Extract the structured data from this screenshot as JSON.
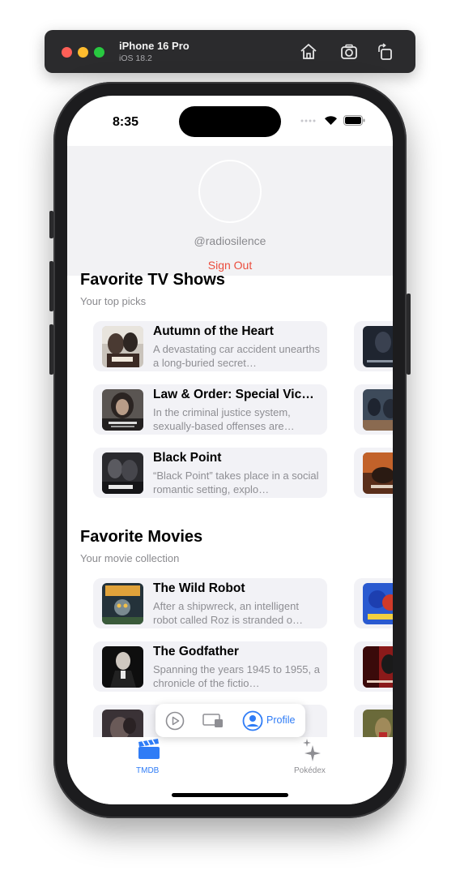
{
  "simulator": {
    "device": "iPhone 16 Pro",
    "os": "iOS 18.2"
  },
  "status_bar": {
    "time": "8:35"
  },
  "profile": {
    "username": "@radiosilence",
    "sign_out": "Sign Out"
  },
  "tv_section": {
    "title": "Favorite TV Shows",
    "subtitle": "Your top picks",
    "items": [
      {
        "title": "Autumn of the Heart",
        "desc": "A devastating car accident unearths a long-buried secret…"
      },
      {
        "title": "Law & Order: Special Vic…",
        "desc": "In the criminal justice system, sexually-based offenses are…"
      },
      {
        "title": "Black Point",
        "desc": "“Black Point” takes place in a social romantic setting, explo…"
      }
    ]
  },
  "movie_section": {
    "title": "Favorite Movies",
    "subtitle": "Your movie collection",
    "items": [
      {
        "title": "The Wild Robot",
        "desc": "After a shipwreck, an intelligent robot called Roz is stranded o…"
      },
      {
        "title": "The Godfather",
        "desc": "Spanning the years 1945 to 1955, a chronicle of the fictio…"
      }
    ]
  },
  "floating_bar": {
    "profile_label": "Profile"
  },
  "tab_bar": {
    "tabs": [
      {
        "label": "TMDB",
        "icon": "clapperboard-icon",
        "color": "#2f7cf6"
      },
      {
        "label": "Pokédex",
        "icon": "sparkles-icon",
        "color": "#8e8e93"
      }
    ]
  },
  "colors": {
    "accent": "#2f7cf6",
    "destructive": "#eb4d3d"
  }
}
